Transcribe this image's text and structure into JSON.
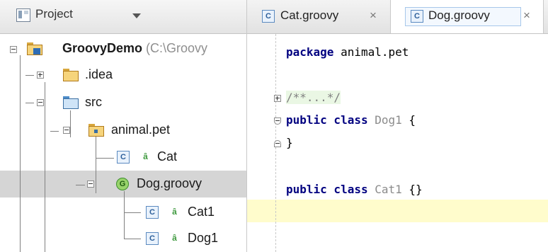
{
  "project_panel": {
    "view_label": "Project",
    "tree": {
      "root": {
        "name": "GroovyDemo",
        "path": "(C:\\Groovy"
      },
      "idea": ".idea",
      "src": "src",
      "package": "animal.pet",
      "cat": {
        "icon": "C",
        "name": "Cat"
      },
      "dog_groovy": {
        "icon": "G",
        "name": "Dog.groovy"
      },
      "cat1": {
        "icon": "C",
        "name": "Cat1"
      },
      "dog1": {
        "icon": "C",
        "name": "Dog1"
      }
    }
  },
  "editor": {
    "tabs": [
      {
        "icon": "C",
        "title": "Cat.groovy",
        "close": "×"
      },
      {
        "icon": "C",
        "title": "Dog.groovy",
        "close": "×"
      }
    ],
    "code": {
      "line1": {
        "keyword": "package",
        "rest": " animal.pet"
      },
      "line3": {
        "comment": "/**...*/"
      },
      "line4": {
        "keyword": "public class",
        "class_name": "Dog1",
        "rest": " {"
      },
      "line5": {
        "rest": "}"
      },
      "line7": {
        "keyword": "public class",
        "class_name": "Cat1",
        "rest": " {}"
      }
    }
  }
}
